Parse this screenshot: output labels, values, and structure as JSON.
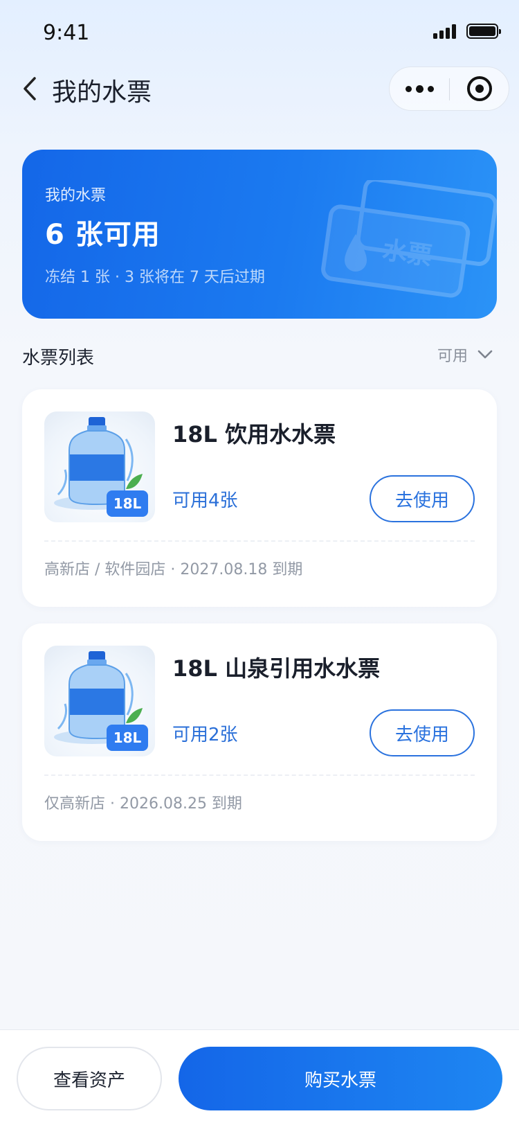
{
  "status_bar": {
    "time": "9:41"
  },
  "nav": {
    "title": "我的水票"
  },
  "summary": {
    "label": "我的水票",
    "count_text": "6 张可用",
    "sub_text": "冻结 1 张 · 3 张将在 7 天后过期",
    "decor_text": "水票"
  },
  "list": {
    "title": "水票列表",
    "filter_value": "可用",
    "tickets": [
      {
        "name": "18L 饮用水水票",
        "size_tag": "18L",
        "available": "可用4张",
        "use_label": "去使用",
        "meta": "高新店 / 软件园店 · 2027.08.18 到期"
      },
      {
        "name": "18L 山泉引用水水票",
        "size_tag": "18L",
        "available": "可用2张",
        "use_label": "去使用",
        "meta": "仅高新店 · 2026.08.25 到期"
      }
    ]
  },
  "bottom_bar": {
    "assets_label": "查看资产",
    "buy_label": "购买水票"
  },
  "colors": {
    "accent": "#1b7af0",
    "link_blue": "#2a72de",
    "page_bg": "#f5f7fb",
    "muted_text": "#9299a5"
  },
  "icons": {
    "back": "chevron-left-icon",
    "more": "more-dots-icon",
    "close_target": "target-icon",
    "filter": "chevron-down-icon",
    "ticket_thumb": "water-bottle-icon"
  }
}
